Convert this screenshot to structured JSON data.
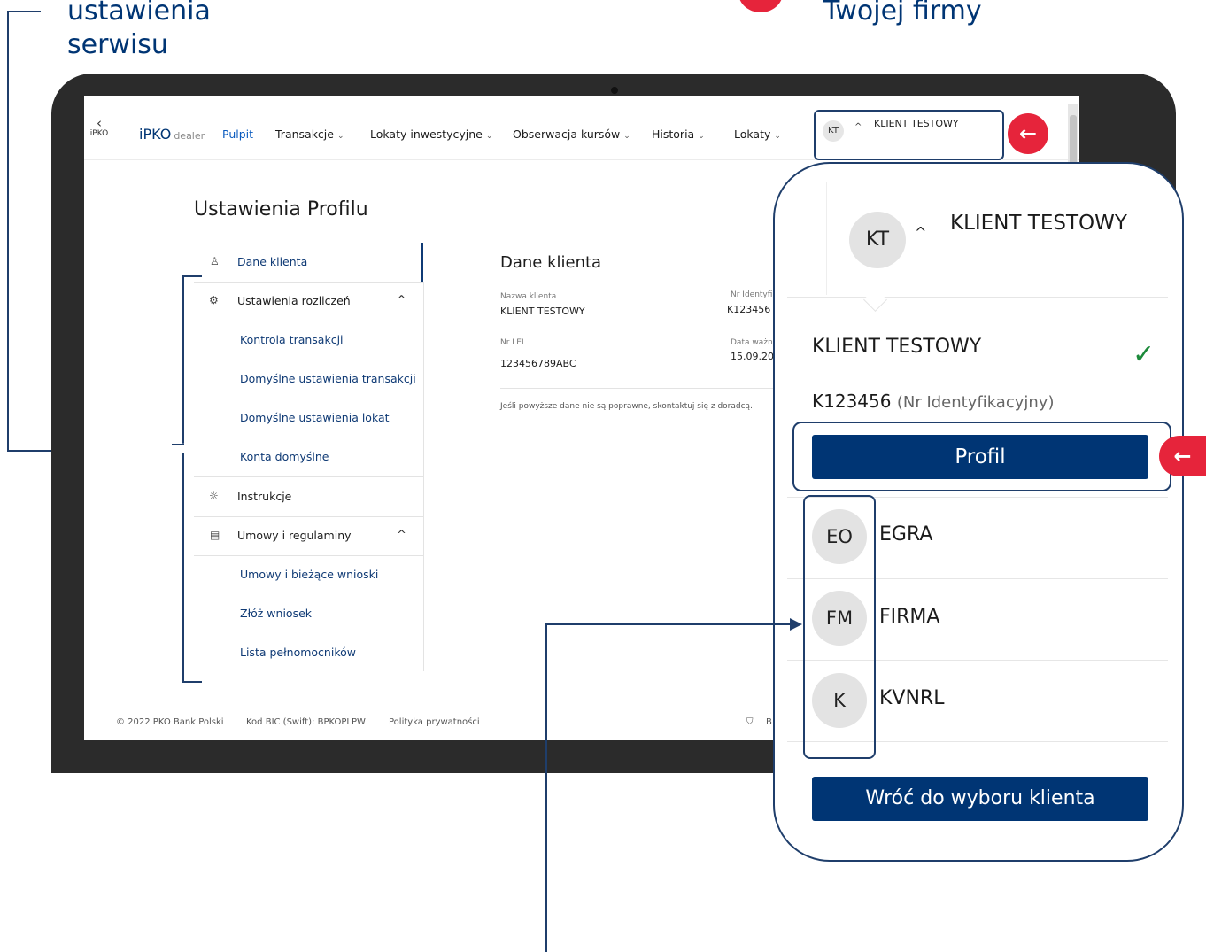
{
  "annotations": {
    "top_left_line1": "ustawienia",
    "top_left_line2": "serwisu",
    "top_right": "Twojej firmy"
  },
  "nav": {
    "back_label": "iPKO",
    "logo_main": "iPKO",
    "logo_sub": "dealer",
    "items": [
      {
        "label": "Pulpit"
      },
      {
        "label": "Transakcje"
      },
      {
        "label": "Lokaty inwestycyjne"
      },
      {
        "label": "Obserwacja kursów"
      },
      {
        "label": "Historia"
      },
      {
        "label": "Lokaty"
      }
    ],
    "user_initials": "KT",
    "user_name": "KLIENT TESTOWY"
  },
  "page": {
    "title": "Ustawienia Profilu",
    "menu": [
      {
        "label": "Dane klienta"
      },
      {
        "label": "Ustawienia rozliczeń"
      },
      {
        "label": "Kontrola transakcji"
      },
      {
        "label": "Domyślne ustawienia transakcji"
      },
      {
        "label": "Domyślne ustawienia lokat"
      },
      {
        "label": "Konta domyślne"
      },
      {
        "label": "Instrukcje"
      },
      {
        "label": "Umowy i regulaminy"
      },
      {
        "label": "Umowy i bieżące wnioski"
      },
      {
        "label": "Złóż wniosek"
      },
      {
        "label": "Lista pełnomocników"
      }
    ],
    "details": {
      "title": "Dane klienta",
      "client_name_label": "Nazwa klienta",
      "client_name": "KLIENT TESTOWY",
      "id_label": "Nr Identyfi",
      "id_value": "K123456",
      "lei_label": "Nr LEI",
      "lei_value": "123456789ABC",
      "validity_label": "Data ważn",
      "validity_value": "15.09.20",
      "note": "Jeśli powyższe dane nie są poprawne, skontaktuj się z doradcą."
    }
  },
  "footer": {
    "copyright": "© 2022 PKO Bank Polski",
    "bic": "Kod BIC (Swift): BPKOPLPW",
    "privacy": "Polityka prywatności",
    "extra": "B"
  },
  "zoom": {
    "user_initials": "KT",
    "user_name": "KLIENT TESTOWY",
    "client_name": "KLIENT TESTOWY",
    "client_id": "K123456",
    "client_id_label": "(Nr Identyfikacyjny)",
    "profile_button": "Profil",
    "firms": [
      {
        "initials": "EO",
        "name": "EGRA"
      },
      {
        "initials": "FM",
        "name": "FIRMA"
      },
      {
        "initials": "K",
        "name": "KVNRL"
      }
    ],
    "back_button": "Wróć do wyboru klienta"
  },
  "colors": {
    "brand": "#003574",
    "accent_red": "#e6243b",
    "link": "#0f3a75"
  }
}
